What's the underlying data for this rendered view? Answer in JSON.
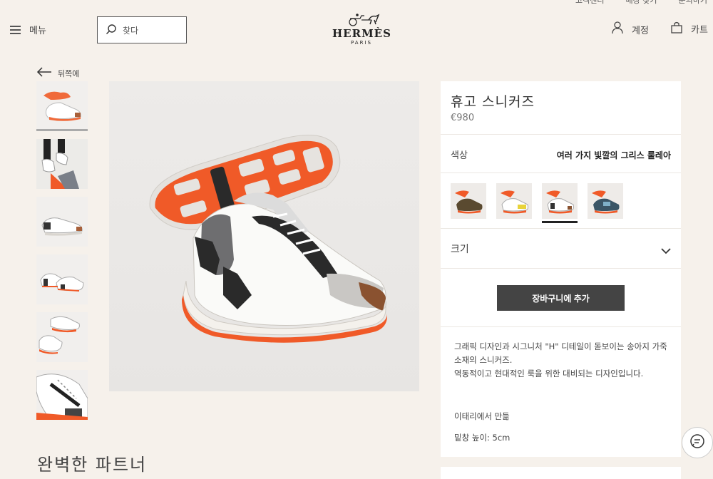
{
  "header": {
    "utility_links": [
      "고객센터",
      "매장 찾기",
      "문의하기"
    ],
    "menu_label": "메뉴",
    "search_label": "찾다",
    "logo_brand": "HERMÈS",
    "logo_city": "PARIS",
    "account_label": "계정",
    "cart_label": "카트"
  },
  "back_label": "뒤쪽에",
  "product": {
    "title": "휴고 스니커즈",
    "price": "€980",
    "color_label": "색상",
    "color_value": "여러 가지 빛깔의 그리스 룰레아",
    "size_label": "크기",
    "add_to_cart": "장바구니에 추가",
    "description_1": "그래픽 디자인과 시그니처 \"H\" 디테일이 돋보이는 송아지 가죽 소재의 스니커즈.",
    "description_2": "역동적이고 현대적인 룩을 위한 대비되는 디자인입니다.",
    "made_in": "이태리에서 만듦",
    "sole_height": "밑창 높이: 5cm"
  },
  "section_title": "완벽한 파트너",
  "colors": {
    "accent_orange": "#f05a28",
    "button_dark": "#444444",
    "background": "#f6f1eb"
  },
  "icons": [
    "hamburger-icon",
    "search-icon",
    "account-icon",
    "cart-icon",
    "arrow-left-icon",
    "chevron-down-icon",
    "chat-icon"
  ]
}
